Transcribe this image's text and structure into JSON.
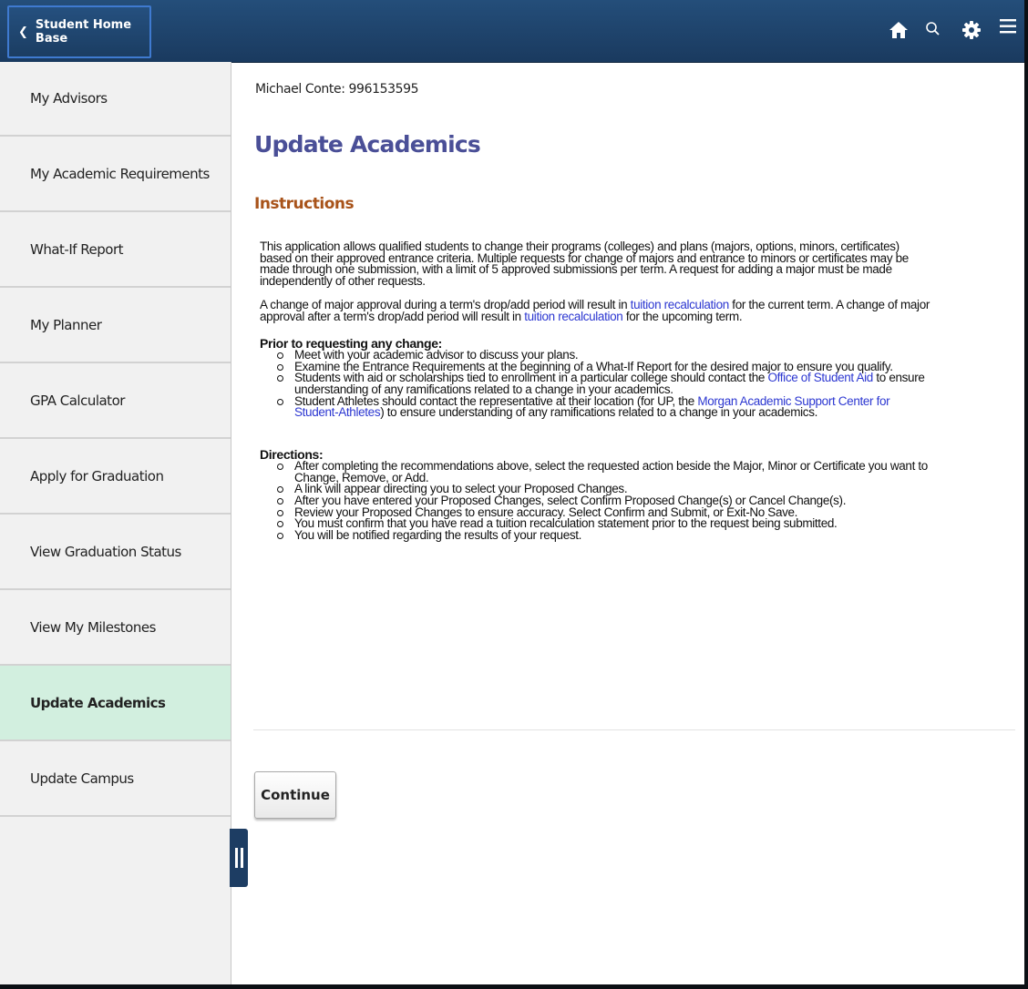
{
  "header": {
    "back_button_label": "Student Home Base",
    "icons": [
      "home-icon",
      "search-icon",
      "gear-icon",
      "menu-icon"
    ]
  },
  "sidebar": {
    "items": [
      {
        "label": "My Advisors"
      },
      {
        "label": "My Academic Requirements"
      },
      {
        "label": "What-If Report"
      },
      {
        "label": "My Planner"
      },
      {
        "label": "GPA Calculator"
      },
      {
        "label": "Apply for Graduation"
      },
      {
        "label": "View Graduation Status"
      },
      {
        "label": "View My Milestones"
      },
      {
        "label": "Update Academics",
        "active": true
      },
      {
        "label": "Update Campus"
      }
    ]
  },
  "main": {
    "student": "Michael Conte: 996153595",
    "title": "Update Academics",
    "section_title": "Instructions",
    "para1": "This application allows qualified students to change their programs (colleges) and plans (majors, options, minors, certificates) based on their approved entrance criteria. Multiple requests for change of majors and entrance to minors or certificates may be made through one submission, with a limit of 5 approved submissions per term. A request for adding a major must be made independently of other requests.",
    "para2": {
      "t1": "A change of major approval during a term's drop/add period will result in ",
      "link1": "tuition recalculation",
      "t2": " for the current term. A change of major approval after a term's drop/add period will result in ",
      "link2": "tuition recalculation",
      "t3": " for the upcoming term."
    },
    "prior_heading": "Prior to requesting any change:",
    "prior_items": {
      "item1": "Meet with your academic advisor to discuss your plans.",
      "item2": "Examine the Entrance Requirements at the beginning of a What-If Report for the desired major to ensure you qualify.",
      "item3_a": "Students with aid or scholarships tied to enrollment in a particular college should contact the ",
      "item3_link": "Office of Student Aid",
      "item3_b": " to ensure understanding of any ramifications related to a change in your academics.",
      "item4_a": "Student Athletes should contact the representative at their location (for UP, the ",
      "item4_link": "Morgan Academic Support Center for Student-Athletes",
      "item4_b": ") to ensure understanding of any ramifications related to a change in your academics."
    },
    "directions_heading": "Directions:",
    "directions": [
      "After completing the recommendations above, select the requested action beside the Major, Minor or Certificate you want to Change, Remove, or Add.",
      "A link will appear directing you to select your Proposed Changes.",
      "After you have entered your Proposed Changes, select Confirm Proposed Change(s) or Cancel Change(s).",
      "Review your Proposed Changes to ensure accuracy. Select Confirm and Submit, or Exit-No Save.",
      "You must confirm that you have read a tuition recalculation statement prior to the request being submitted.",
      "You will be notified regarding the results of your request."
    ],
    "continue_label": "Continue"
  },
  "colors": {
    "header_bg": "#1f4670",
    "title": "#4a4f97",
    "section_title": "#a8531a",
    "link": "#2c37d1",
    "active_item_bg": "#d2efdf"
  }
}
